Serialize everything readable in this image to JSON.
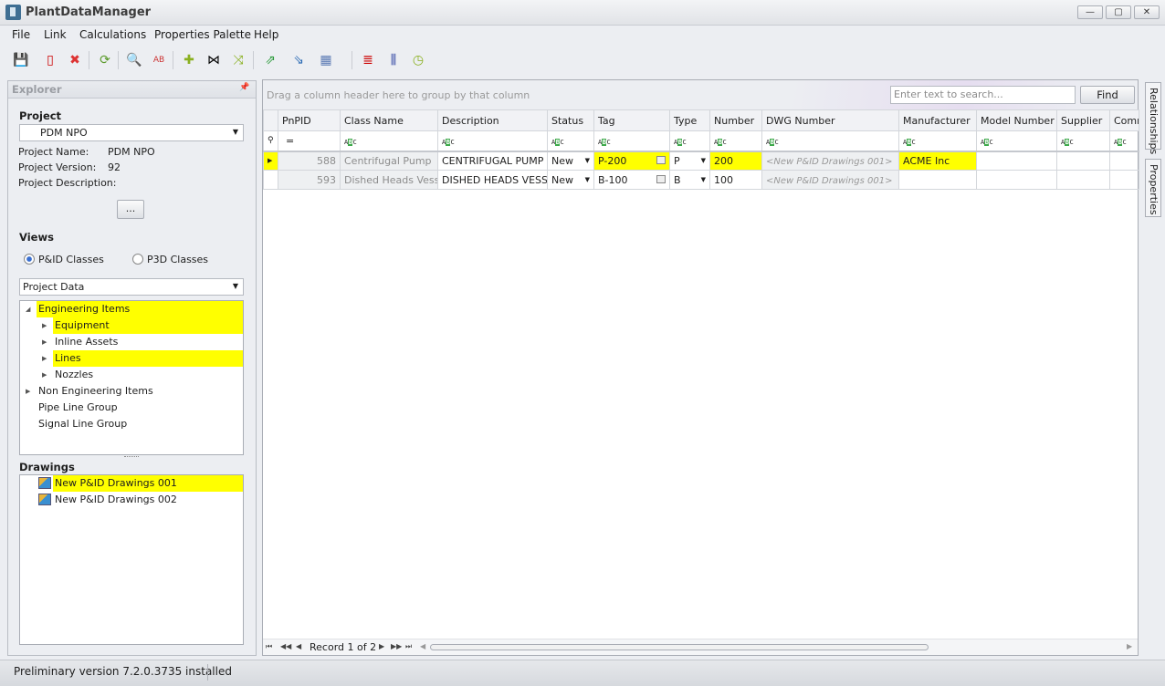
{
  "window": {
    "title": "PlantDataManager",
    "controls": [
      "—",
      "▢",
      "✕"
    ]
  },
  "menu": [
    "File",
    "Link",
    "Calculations",
    "Properties Palette",
    "Help"
  ],
  "toolbar": [
    {
      "icon": "save-icon",
      "glyph": "💾",
      "color": "#2a3f9a"
    },
    {
      "icon": "close-document-icon",
      "glyph": "▯",
      "color": "#c00"
    },
    {
      "icon": "delete-icon",
      "glyph": "✖",
      "color": "#d33"
    },
    {
      "icon": "refresh-icon",
      "glyph": "⟳",
      "color": "#5a9a2a"
    },
    {
      "icon": "search-icon",
      "glyph": "🔍",
      "color": "#1a5fb4"
    },
    {
      "icon": "replace-icon",
      "glyph": "AB",
      "color": "#c33"
    },
    {
      "icon": "add-icon",
      "glyph": "✚",
      "color": "#8ab020"
    },
    {
      "icon": "add-connected-icon",
      "glyph": "⋈",
      "color": "#000"
    },
    {
      "icon": "shuffle-icon",
      "glyph": "⤨",
      "color": "#8ab020"
    },
    {
      "icon": "export-icon",
      "glyph": "⇗",
      "color": "#2a9a3a"
    },
    {
      "icon": "import-icon",
      "glyph": "⇘",
      "color": "#2a6ab4"
    },
    {
      "icon": "table-layout-icon",
      "glyph": "▦",
      "color": "#5a7ab4"
    },
    {
      "icon": "highlight-colors-icon",
      "glyph": "≣",
      "color": "#c00"
    },
    {
      "icon": "columns-icon",
      "glyph": "⫼",
      "color": "#2a3fa0"
    },
    {
      "icon": "history-icon",
      "glyph": "◷",
      "color": "#8ab020"
    }
  ],
  "explorer": {
    "title": "Explorer",
    "project_heading": "Project",
    "project_selected": "PDM NPO",
    "project_name_label": "Project Name:",
    "project_name": "PDM NPO",
    "project_version_label": "Project Version:",
    "project_version": "92",
    "project_description_label": "Project Description:",
    "more_button": "...",
    "views_heading": "Views",
    "radio_pid": "P&ID Classes",
    "radio_p3d": "P3D Classes",
    "radio_selected": "P&ID Classes",
    "view_selected": "Project Data",
    "tree": [
      {
        "label": "Engineering Items",
        "level": 0,
        "expander": "expanded",
        "highlight": true
      },
      {
        "label": "Equipment",
        "level": 1,
        "expander": "collapsed",
        "highlight": true
      },
      {
        "label": "Inline Assets",
        "level": 1,
        "expander": "collapsed",
        "highlight": false
      },
      {
        "label": "Lines",
        "level": 1,
        "expander": "collapsed",
        "highlight": true
      },
      {
        "label": "Nozzles",
        "level": 1,
        "expander": "collapsed",
        "highlight": false
      },
      {
        "label": "Non Engineering Items",
        "level": 0,
        "expander": "collapsed",
        "highlight": false
      },
      {
        "label": "Pipe Line Group",
        "level": 0,
        "expander": "none",
        "highlight": false
      },
      {
        "label": "Signal Line Group",
        "level": 0,
        "expander": "none",
        "highlight": false
      }
    ],
    "drawings_heading": "Drawings",
    "drawings": [
      {
        "label": "New P&ID Drawings 001",
        "highlight": true
      },
      {
        "label": "New P&ID Drawings 002",
        "highlight": false
      }
    ]
  },
  "grid": {
    "group_hint": "Drag a column header here to group by that column",
    "search_placeholder": "Enter text to search...",
    "find_button": "Find",
    "columns": [
      "PnPID",
      "Class Name",
      "Description",
      "Status",
      "Tag",
      "Type",
      "Number",
      "DWG Number",
      "Manufacturer",
      "Model Number",
      "Supplier",
      "Comm"
    ],
    "rows": [
      {
        "current": true,
        "cells": [
          "588",
          "Centrifugal Pump",
          "CENTRIFUGAL PUMP",
          "New",
          "P-200",
          "P",
          "200",
          "<New P&ID Drawings 001>",
          "ACME Inc",
          "",
          "",
          ""
        ],
        "highlight": [
          4,
          6,
          8
        ]
      },
      {
        "current": false,
        "cells": [
          "593",
          "Dished Heads Vessel",
          "DISHED HEADS VESSEL",
          "New",
          "B-100",
          "B",
          "100",
          "<New P&ID Drawings 001>",
          "",
          "",
          "",
          ""
        ],
        "highlight": []
      }
    ],
    "record_text": "Record 1 of 2",
    "highlight_color": "#ffff00"
  },
  "side_tabs": [
    "Relationships",
    "Properties"
  ],
  "status": "Preliminary version 7.2.0.3735 installed"
}
